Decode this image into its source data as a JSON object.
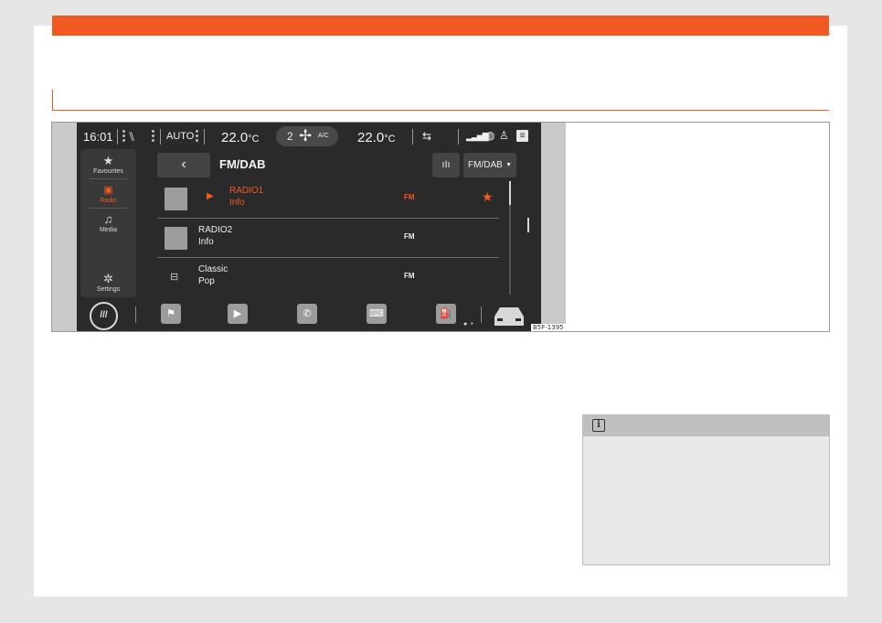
{
  "figure_ref": "B5F-1395",
  "status_bar": {
    "time": "16:01",
    "climate_mode": "AUTO",
    "temp_left": "22.0",
    "temp_right": "22.0",
    "temp_unit": "°C",
    "fan_level": "2",
    "ac_label": "A/C"
  },
  "side_menu": {
    "items": [
      {
        "label": "Favourites",
        "icon": "star-icon"
      },
      {
        "label": "Radio",
        "icon": "radio-icon",
        "active": true
      },
      {
        "label": "Media",
        "icon": "music-note-icon"
      },
      {
        "label": "Settings",
        "icon": "gear-icon"
      }
    ]
  },
  "header": {
    "title": "FM/DAB",
    "source_selected": "FM/DAB"
  },
  "stations": [
    {
      "name": "RADIO1",
      "info": "Info",
      "band": "FM",
      "playing": true,
      "favourite": true
    },
    {
      "name": "RADIO2",
      "info": "Info",
      "band": "FM",
      "playing": false,
      "favourite": false
    },
    {
      "name": "Classic",
      "info": "Pop",
      "band": "FM",
      "playing": false,
      "favourite": false
    }
  ],
  "bottom_bar": {
    "home_label": "///",
    "tiles": [
      "flag-icon",
      "play-icon",
      "phone-icon",
      "keyboard-icon",
      "app-icon"
    ]
  },
  "colors": {
    "accent": "#f05a22",
    "screen_bg": "#2b2a2b",
    "note_bg": "#e8e8e8"
  }
}
